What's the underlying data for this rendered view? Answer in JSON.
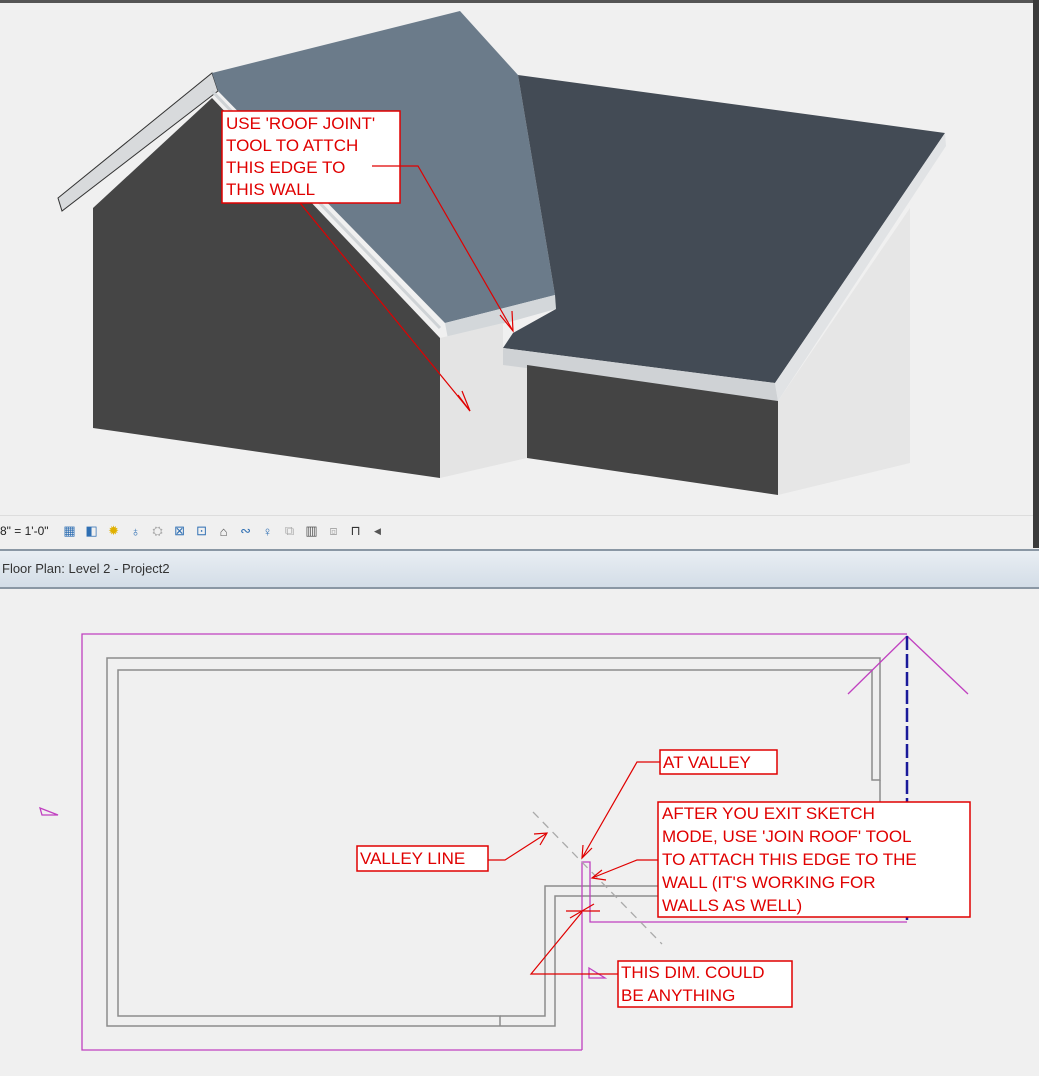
{
  "view3d": {
    "note": [
      "USE 'ROOF JOINT'",
      "TOOL TO ATTCH",
      "THIS EDGE TO",
      "THIS WALL"
    ]
  },
  "toolbar": {
    "scale": "8\" = 1'-0\"",
    "icons": [
      "detail-level-icon",
      "visual-style-icon",
      "sun-path-icon",
      "shadows-icon",
      "render-icon",
      "crop-view-icon",
      "show-crop-icon",
      "temporary-hide-icon",
      "reveal-hidden-icon",
      "lock-3d-icon",
      "analytical-icon",
      "highlight-displacement-icon",
      "worksharing-icon",
      "design-options-icon",
      "constraints-icon"
    ]
  },
  "titlebar": {
    "title": "Floor Plan: Level 2 - Project2"
  },
  "plan": {
    "notes": {
      "valley_line": "VALLEY LINE",
      "at_valley": "AT VALLEY",
      "join_roof": [
        "AFTER YOU EXIT SKETCH",
        "MODE, USE 'JOIN ROOF' TOOL",
        "TO ATTACH THIS EDGE TO THE",
        "WALL (IT'S WORKING FOR",
        "WALLS AS WELL)"
      ],
      "dim": [
        "THIS DIM. COULD",
        "BE ANYTHING"
      ]
    }
  },
  "colors": {
    "annotation": "#e00000",
    "sketch": "#c040c0",
    "wall": "#8c8c8c"
  }
}
